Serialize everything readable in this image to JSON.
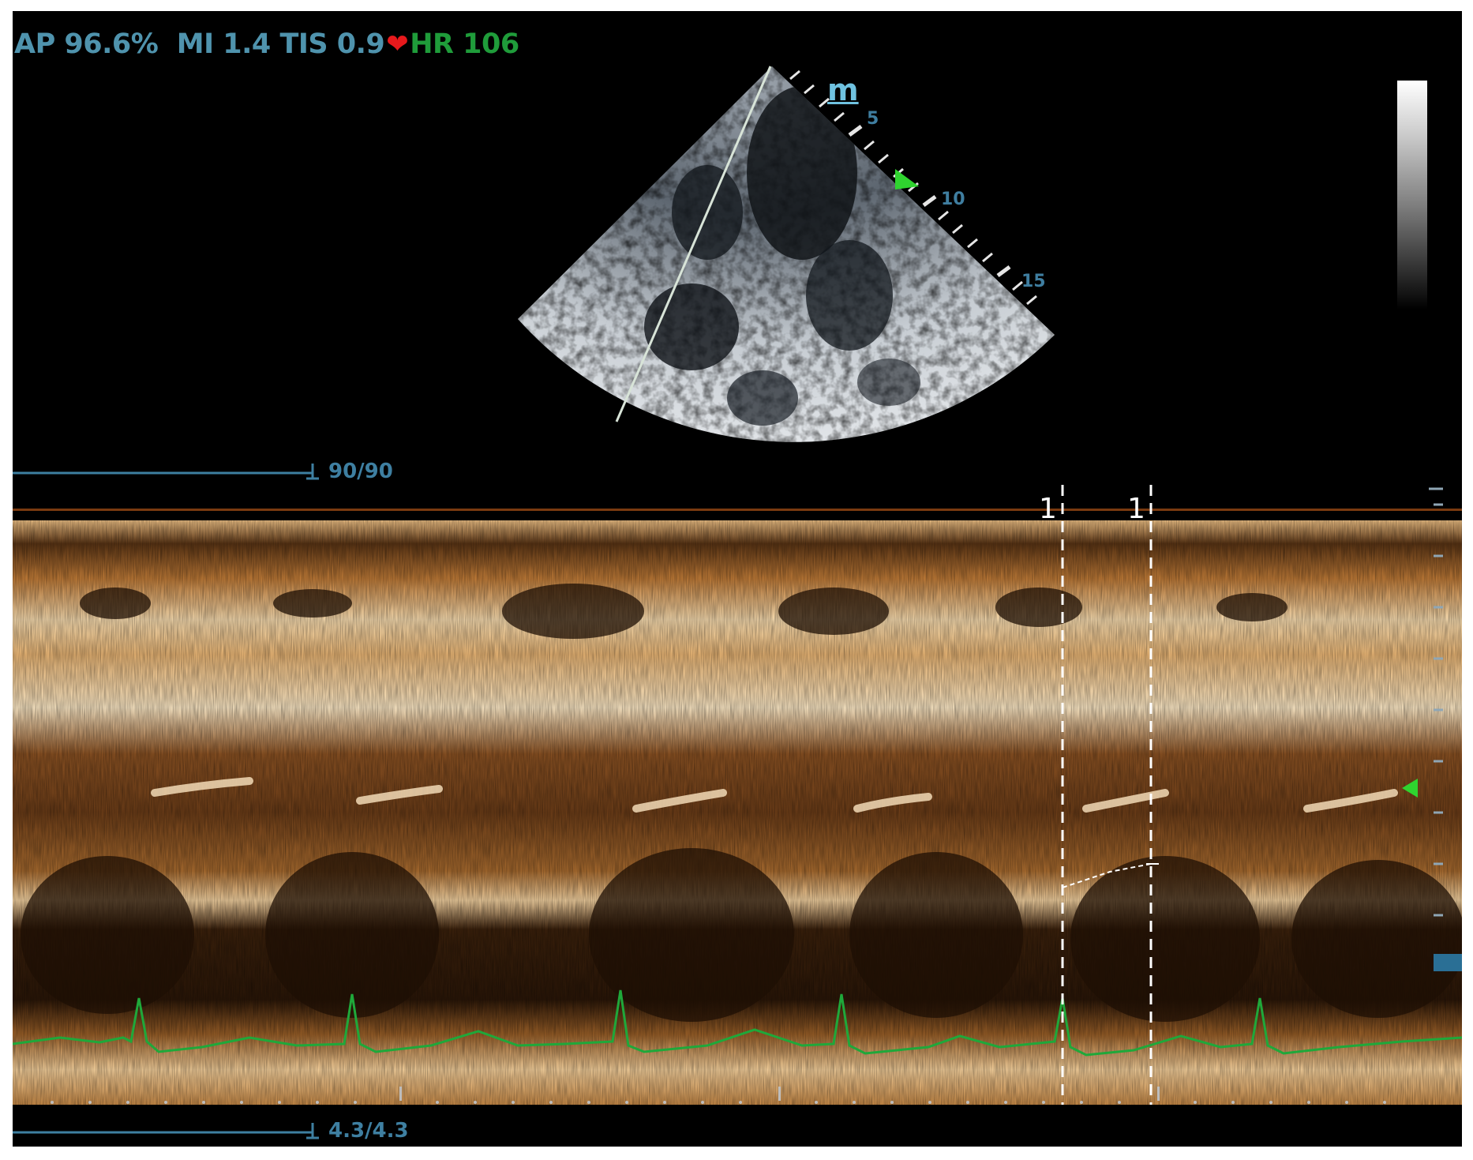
{
  "header": {
    "ap_label": "AP 96.6%",
    "mi_tis": "MI 1.4 TIS 0.9",
    "heart_glyph": "❤",
    "hr": "HR 106"
  },
  "sector": {
    "mode_icon": "m",
    "depth_labels": [
      "5",
      "10",
      "15"
    ]
  },
  "scale_top": {
    "label": "90/90"
  },
  "scale_bottom": {
    "label": "4.3/4.3"
  },
  "calipers": {
    "labels": [
      "1",
      "1"
    ]
  },
  "colors": {
    "readout": "#4f93ad",
    "heart_rate": "#1f9c3a",
    "heart": "#e8191c",
    "ecg": "#1fa83a",
    "marker": "#2fd42f",
    "mmode_tint": "#e3a25c"
  },
  "icons": [
    "heart-icon",
    "m-mode-icon",
    "focus-marker-icon",
    "grayscale-bar",
    "depth-marker-icon"
  ]
}
